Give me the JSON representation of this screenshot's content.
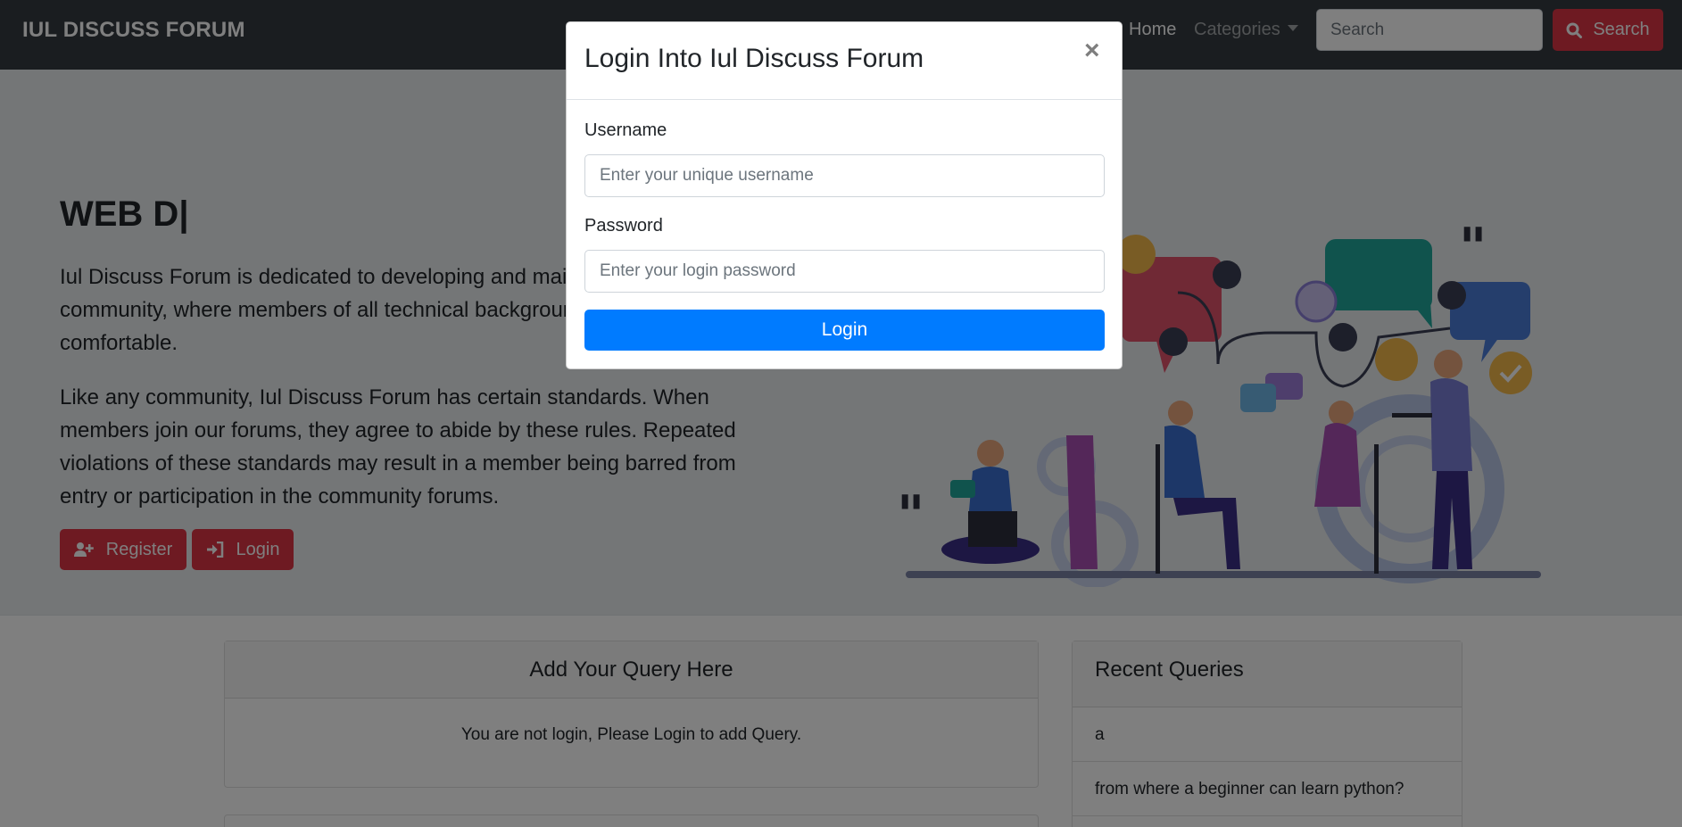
{
  "navbar": {
    "brand": "IUL DISCUSS FORUM",
    "home": "Home",
    "categories": "Categories",
    "search_placeholder": "Search",
    "search_button": "Search"
  },
  "hero": {
    "title": "WEB D|",
    "paragraph1": "Iul Discuss Forum is dedicated to developing and maintaining an online community, where members of all technical backgrounds feel safe and comfortable.",
    "paragraph2": "Like any community, Iul Discuss Forum has certain standards. When members join our forums, they agree to abide by these rules. Repeated violations of these standards may result in a member being barred from entry or participation in the community forums.",
    "register_button": "Register",
    "login_button": "Login"
  },
  "query_card": {
    "title": "Add Your Query Here",
    "message": "You are not login, Please Login to add Query."
  },
  "recent": {
    "title": "Recent Queries",
    "items": [
      "a",
      "from where a beginner can learn python?"
    ]
  },
  "modal": {
    "title": "Login Into Iul Discuss Forum",
    "close": "×",
    "username_label": "Username",
    "username_placeholder": "Enter your unique username",
    "password_label": "Password",
    "password_placeholder": "Enter your login password",
    "login_button": "Login"
  },
  "colors": {
    "navbar": "#343a40",
    "danger": "#dc3545",
    "primary": "#007bff",
    "jumbotron": "#e9ecef"
  }
}
